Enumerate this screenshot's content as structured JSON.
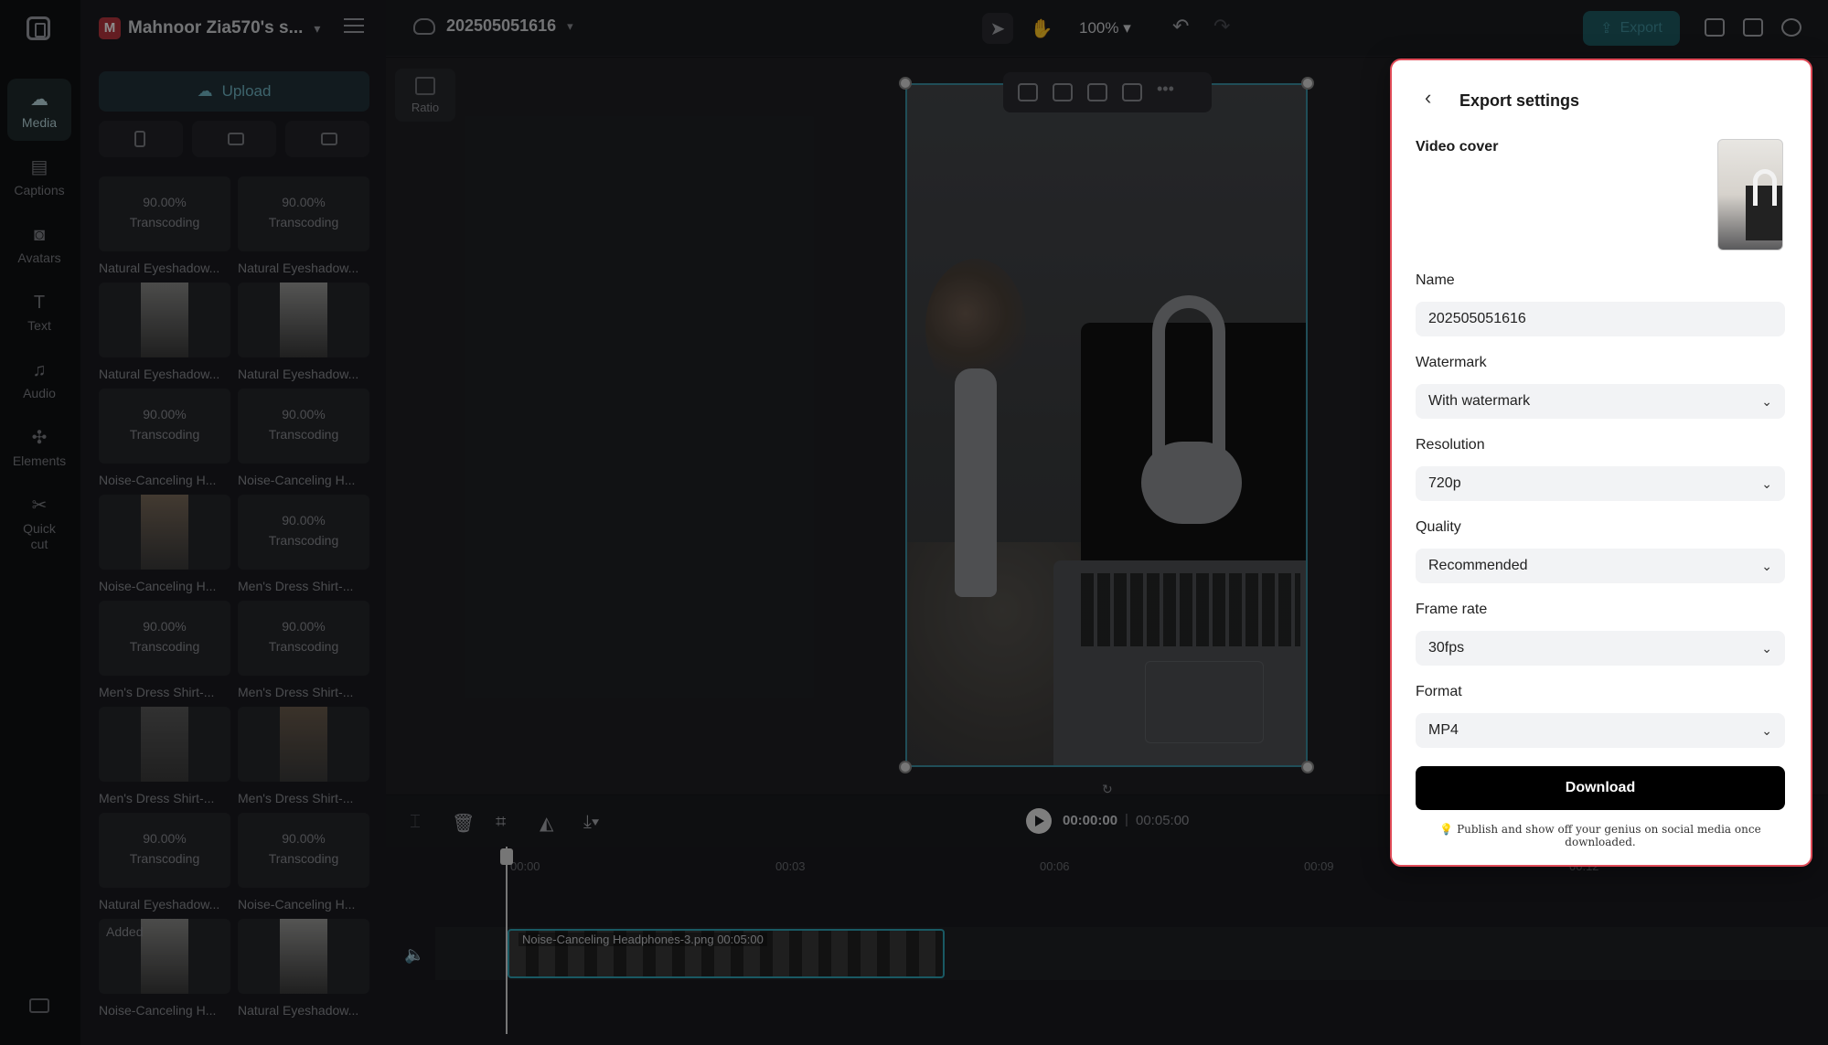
{
  "rail": {
    "items": [
      {
        "label": "Media",
        "icon": "cloud-upload-icon"
      },
      {
        "label": "Captions",
        "icon": "captions-icon"
      },
      {
        "label": "Avatars",
        "icon": "avatar-icon"
      },
      {
        "label": "Text",
        "icon": "text-icon"
      },
      {
        "label": "Audio",
        "icon": "music-icon"
      },
      {
        "label": "Elements",
        "icon": "elements-icon"
      },
      {
        "label": "Quick cut",
        "icon": "quick-cut-icon"
      }
    ]
  },
  "panel": {
    "workspace_initial": "M",
    "workspace_name": "Mahnoor Zia570's s...",
    "upload_label": "Upload",
    "tiles": [
      {
        "pct": "90.00%",
        "status": "Transcoding",
        "caption": "Natural Eyeshadow..."
      },
      {
        "pct": "90.00%",
        "status": "Transcoding",
        "caption": "Natural Eyeshadow..."
      },
      {
        "pct": "",
        "status": "",
        "caption": "Natural Eyeshadow..."
      },
      {
        "pct": "",
        "status": "",
        "caption": "Natural Eyeshadow..."
      },
      {
        "pct": "90.00%",
        "status": "Transcoding",
        "caption": "Noise-Canceling H..."
      },
      {
        "pct": "90.00%",
        "status": "Transcoding",
        "caption": "Noise-Canceling H..."
      },
      {
        "pct": "",
        "status": "",
        "caption": "Noise-Canceling H..."
      },
      {
        "pct": "90.00%",
        "status": "Transcoding",
        "caption": "Men's Dress Shirt-..."
      },
      {
        "pct": "90.00%",
        "status": "Transcoding",
        "caption": "Men's Dress Shirt-..."
      },
      {
        "pct": "90.00%",
        "status": "Transcoding",
        "caption": "Men's Dress Shirt-..."
      },
      {
        "pct": "",
        "status": "",
        "caption": "Men's Dress Shirt-..."
      },
      {
        "pct": "",
        "status": "",
        "caption": "Men's Dress Shirt-..."
      },
      {
        "pct": "90.00%",
        "status": "Transcoding",
        "caption": "Natural Eyeshadow..."
      },
      {
        "pct": "90.00%",
        "status": "Transcoding",
        "caption": "Noise-Canceling H..."
      },
      {
        "pct": "",
        "status": "",
        "caption": "Noise-Canceling H...",
        "badge": "Added"
      },
      {
        "pct": "",
        "status": "",
        "caption": "Natural Eyeshadow..."
      }
    ]
  },
  "topbar": {
    "project_name": "202505051616",
    "zoom": "100%",
    "export_label": "Export"
  },
  "canvas": {
    "ratio_label": "Ratio"
  },
  "timeline": {
    "current_time": "00:00:00",
    "separator": "|",
    "total_time": "00:05:00",
    "ruler": [
      "00:00",
      "00:03",
      "00:06",
      "00:09",
      "00:12"
    ],
    "clip_label": "Noise-Canceling Headphones-3.png   00:05:00"
  },
  "export_panel": {
    "title": "Export settings",
    "video_cover_label": "Video cover",
    "name_label": "Name",
    "name_value": "202505051616",
    "watermark_label": "Watermark",
    "watermark_value": "With watermark",
    "resolution_label": "Resolution",
    "resolution_value": "720p",
    "quality_label": "Quality",
    "quality_value": "Recommended",
    "framerate_label": "Frame rate",
    "framerate_value": "30fps",
    "format_label": "Format",
    "format_value": "MP4",
    "download_label": "Download",
    "tip": "💡 Publish and show off your genius on social media once downloaded."
  },
  "colors": {
    "accent": "#2fa3b5",
    "export_border": "#e04b58",
    "download_bg": "#000000"
  }
}
